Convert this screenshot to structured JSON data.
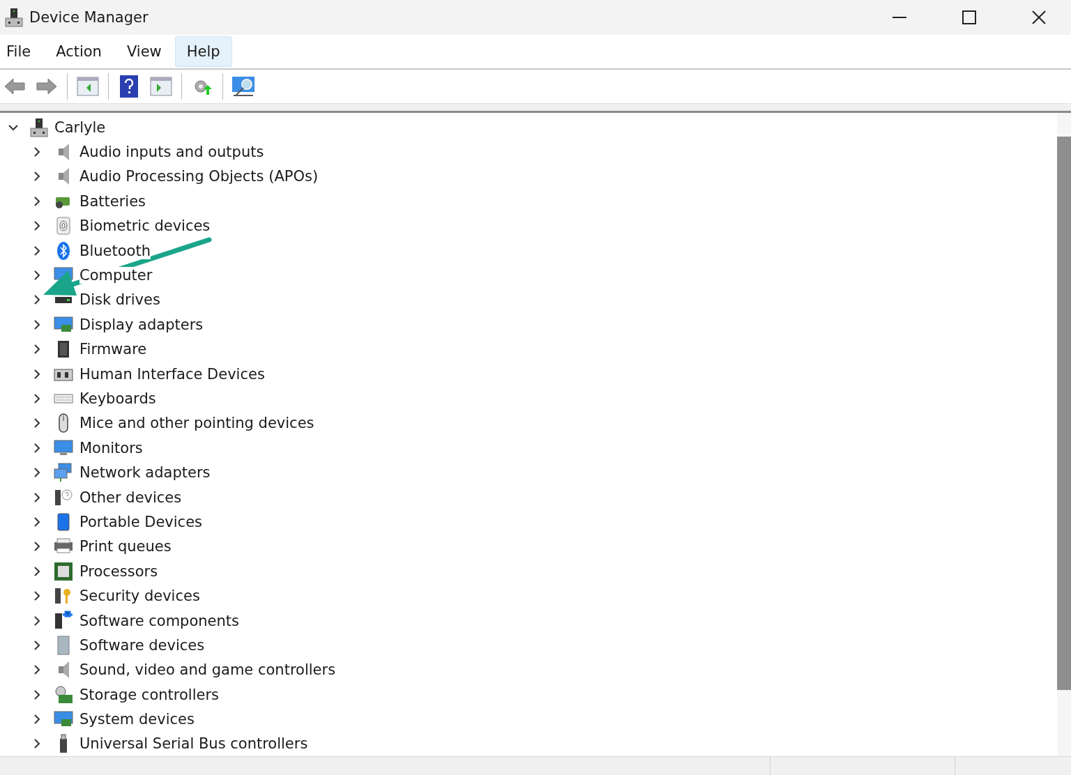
{
  "window": {
    "title": "Device Manager"
  },
  "menu": [
    {
      "label": "File",
      "selected": false
    },
    {
      "label": "Action",
      "selected": false
    },
    {
      "label": "View",
      "selected": false
    },
    {
      "label": "Help",
      "selected": true
    }
  ],
  "tree": {
    "label": "Carlyle",
    "expanded": true,
    "children": [
      {
        "label": "Audio inputs and outputs",
        "kind": "speaker",
        "expanded": false
      },
      {
        "label": "Audio Processing Objects (APOs)",
        "kind": "speaker",
        "expanded": false
      },
      {
        "label": "Batteries",
        "kind": "battery",
        "expanded": false
      },
      {
        "label": "Biometric devices",
        "kind": "fingerprint",
        "expanded": false
      },
      {
        "label": "Bluetooth",
        "kind": "bluetooth",
        "expanded": false
      },
      {
        "label": "Computer",
        "kind": "monitor",
        "expanded": false
      },
      {
        "label": "Disk drives",
        "kind": "disk",
        "expanded": false
      },
      {
        "label": "Display adapters",
        "kind": "display",
        "expanded": false
      },
      {
        "label": "Firmware",
        "kind": "chip",
        "expanded": false
      },
      {
        "label": "Human Interface Devices",
        "kind": "hid",
        "expanded": false
      },
      {
        "label": "Keyboards",
        "kind": "keyboard",
        "expanded": false
      },
      {
        "label": "Mice and other pointing devices",
        "kind": "mouse",
        "expanded": false
      },
      {
        "label": "Monitors",
        "kind": "monitor",
        "expanded": false
      },
      {
        "label": "Network adapters",
        "kind": "network",
        "expanded": false
      },
      {
        "label": "Other devices",
        "kind": "unknown",
        "expanded": false
      },
      {
        "label": "Portable Devices",
        "kind": "portable",
        "expanded": false
      },
      {
        "label": "Print queues",
        "kind": "printer",
        "expanded": false
      },
      {
        "label": "Processors",
        "kind": "cpu",
        "expanded": false
      },
      {
        "label": "Security devices",
        "kind": "key",
        "expanded": false
      },
      {
        "label": "Software components",
        "kind": "component",
        "expanded": false
      },
      {
        "label": "Software devices",
        "kind": "softdevice",
        "expanded": false
      },
      {
        "label": "Sound, video and game controllers",
        "kind": "speaker",
        "expanded": false
      },
      {
        "label": "Storage controllers",
        "kind": "storage",
        "expanded": false
      },
      {
        "label": "System devices",
        "kind": "display",
        "expanded": false
      },
      {
        "label": "Universal Serial Bus controllers",
        "kind": "usb",
        "expanded": false
      }
    ]
  }
}
